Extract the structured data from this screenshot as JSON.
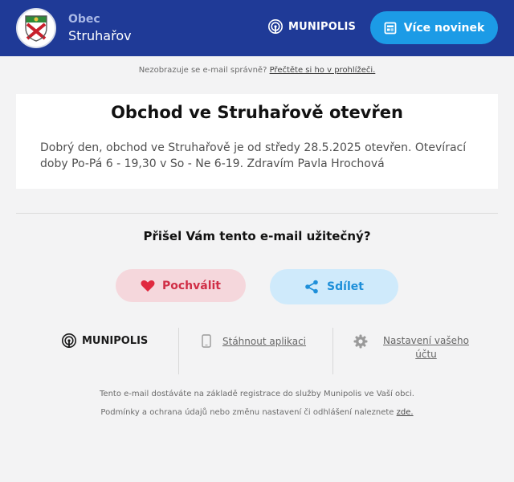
{
  "header": {
    "org_kicker": "Obec",
    "org_name": "Struhařov",
    "brand": "MUNIPOLIS",
    "more_news_label": "Více novinek",
    "crest_icon": "municipality-crest-icon",
    "brand_icon": "munipolis-signal-icon",
    "more_news_icon": "news-icon"
  },
  "preheader": {
    "text": "Nezobrazuje se e-mail správně?",
    "link": "Přečtěte si ho v prohlížeči."
  },
  "message": {
    "title": "Obchod ve Struhařově otevřen",
    "body": "Dobrý den, obchod ve Struhařově je od středy 28.5.2025 otevřen. Otevírací doby Po-Pá 6 - 19,30 v So - Ne 6-19. Zdravím Pavla Hrochová"
  },
  "feedback": {
    "question": "Přišel Vám tento e-mail užitečný?",
    "praise_label": "Pochválit",
    "share_label": "Sdílet",
    "praise_icon": "heart-icon",
    "share_icon": "share-icon"
  },
  "footer_links": {
    "brand": "MUNIPOLIS",
    "app_label": "Stáhnout aplikaci",
    "settings_label": "Nastavení vašeho účtu",
    "app_icon": "phone-icon",
    "settings_icon": "gear-icon"
  },
  "footer": {
    "line1": "Tento e-mail dostáváte na základě registrace do služby Munipolis ve Vaší obci.",
    "line2": "Podmínky a ochrana údajů nebo změnu nastavení či odhlášení naleznete",
    "line2_link": "zde."
  },
  "colors": {
    "header_bg": "#1f3a97",
    "accent_blue": "#1c9be6",
    "praise_bg": "#f5d7dc",
    "praise_text": "#d02e46",
    "share_bg": "#cfeafb",
    "share_text": "#1e8fd9"
  }
}
